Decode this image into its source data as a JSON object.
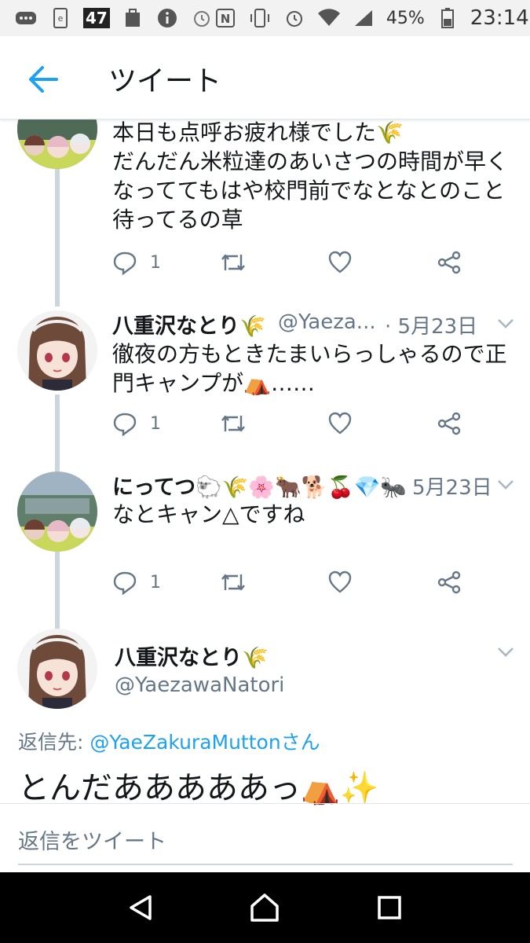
{
  "status_bar": {
    "badge": "47",
    "battery": "45%",
    "time": "23:14"
  },
  "header": {
    "title": "ツイート"
  },
  "thread": [
    {
      "text": "本日も点呼お疲れ様でした🌾\nだんだん米粒達のあいさつの時間が早くなっててもはや校門前でなとなとのこと待ってるの草",
      "reply_count": "1"
    },
    {
      "name": "八重沢なとり🌾",
      "handle": "@Yaeza...",
      "date": "· 5月23日",
      "text": "徹夜の方もときたまいらっしゃるので正門キャンプが⛺……",
      "reply_count": "1"
    },
    {
      "name": "にってつ🐑🌾🌸🐂🐕🍒💎🐜",
      "date": "5月23日",
      "text": "なとキャン△ですね",
      "reply_count": "1"
    }
  ],
  "main_tweet": {
    "name": "八重沢なとり🌾",
    "handle": "@YaezawaNatori",
    "reply_label": "返信先:",
    "reply_link": "@YaeZakuraMuttonさん",
    "text": "とんだあああああっ⛺✨"
  },
  "compose": {
    "placeholder": "返信をツイート"
  },
  "colors": {
    "accent": "#1da1f2",
    "muted": "#657786",
    "thread_line": "#ccd6dd"
  }
}
